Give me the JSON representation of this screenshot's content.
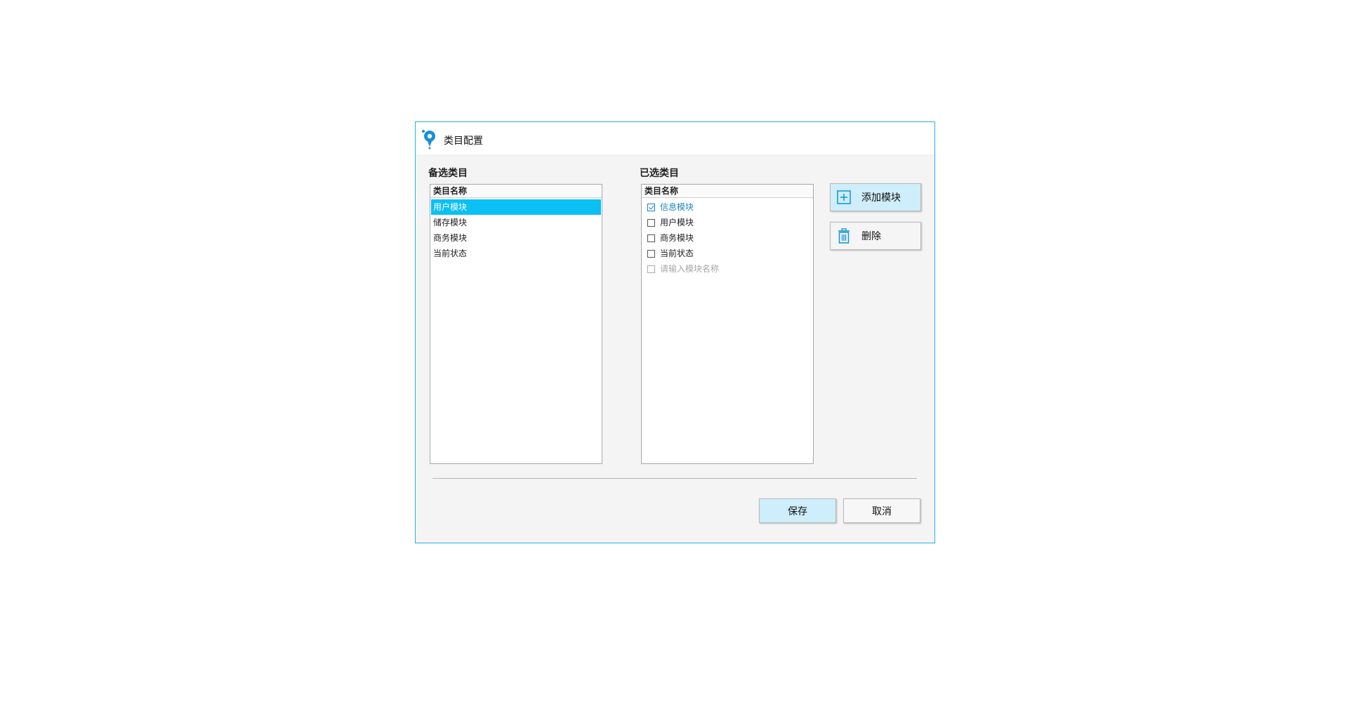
{
  "dialog": {
    "title": "类目配置",
    "icon": "app-logo-icon",
    "accent_color": "#2ab0e6"
  },
  "available": {
    "label": "备选类目",
    "column_header": "类目名称",
    "items": [
      {
        "label": "用户模块",
        "selected": true
      },
      {
        "label": "储存模块",
        "selected": false
      },
      {
        "label": "商务模块",
        "selected": false
      },
      {
        "label": "当前状态",
        "selected": false
      }
    ]
  },
  "chosen": {
    "label": "已选类目",
    "column_header": "类目名称",
    "items": [
      {
        "label": "信息模块",
        "checked": true
      },
      {
        "label": "用户模块",
        "checked": false
      },
      {
        "label": "商务模块",
        "checked": false
      },
      {
        "label": "当前状态",
        "checked": false
      }
    ],
    "new_item_placeholder": "请输入模块名称"
  },
  "actions": {
    "add_label": "添加模块",
    "add_icon": "plus-square-icon",
    "delete_label": "删除",
    "delete_icon": "trash-icon",
    "save_label": "保存",
    "cancel_label": "取消",
    "primary_button_color": "#cdeefa",
    "selection_color": "#0ac0f4"
  }
}
